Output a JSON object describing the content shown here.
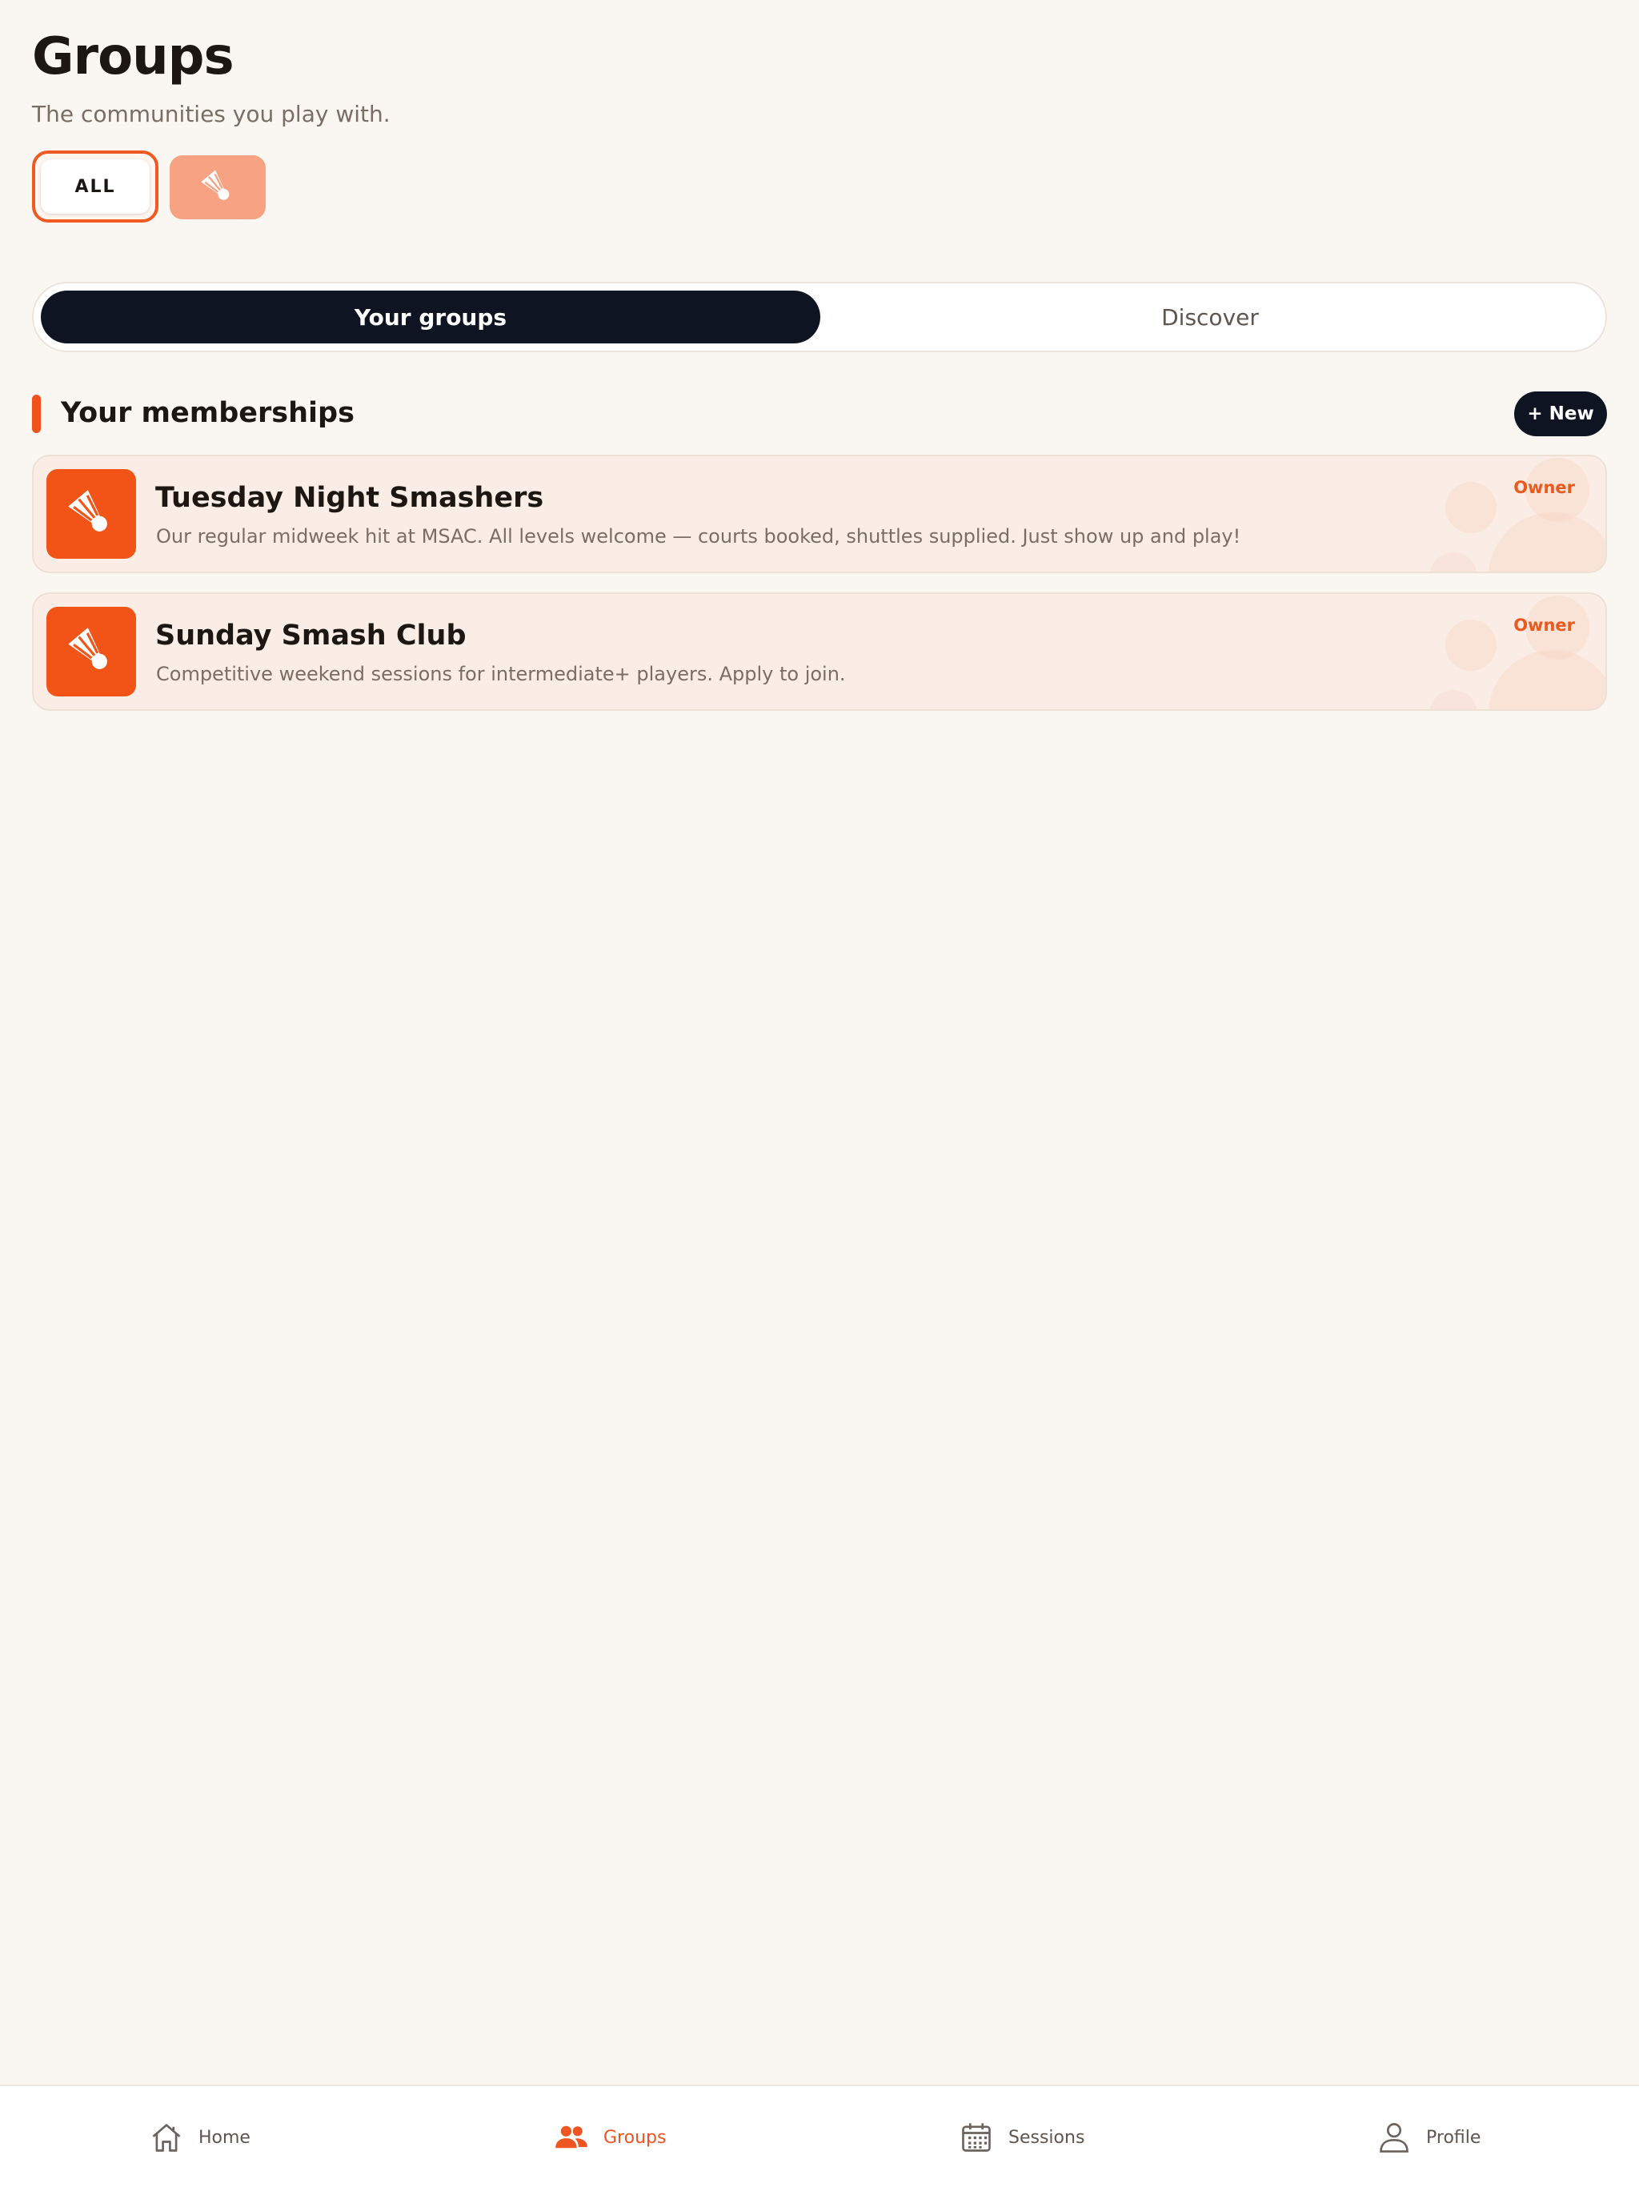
{
  "header": {
    "title": "Groups",
    "subtitle": "The communities you play with."
  },
  "filters": {
    "all_label": "ALL",
    "sport_icon": "shuttlecock-icon",
    "selected": "ALL"
  },
  "segmented": {
    "active_label": "Your groups",
    "inactive_label": "Discover"
  },
  "section": {
    "title": "Your memberships",
    "new_label": "+ New"
  },
  "groups": [
    {
      "name": "Tuesday Night Smashers",
      "description": "Our regular midweek hit at MSAC. All levels welcome — courts booked, shuttles supplied. Just show up and play!",
      "role": "Owner",
      "icon": "shuttlecock-icon"
    },
    {
      "name": "Sunday Smash Club",
      "description": "Competitive weekend sessions for intermediate+ players. Apply to join.",
      "role": "Owner",
      "icon": "shuttlecock-icon"
    }
  ],
  "tabbar": {
    "items": [
      {
        "label": "Home",
        "icon": "home-icon",
        "active": false
      },
      {
        "label": "Groups",
        "icon": "people-icon",
        "active": true
      },
      {
        "label": "Sessions",
        "icon": "calendar-icon",
        "active": false
      },
      {
        "label": "Profile",
        "icon": "person-icon",
        "active": false
      }
    ]
  },
  "colors": {
    "accent": "#f05a22",
    "dark": "#0f1422",
    "background": "#faf6f2"
  }
}
